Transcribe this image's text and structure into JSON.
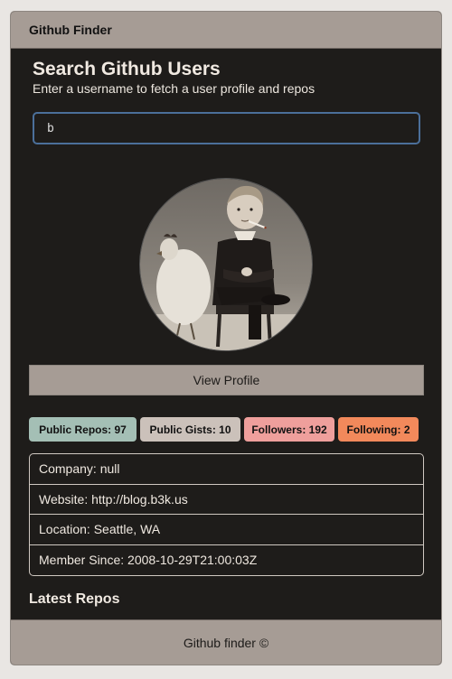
{
  "navbar": {
    "brand": "Github Finder"
  },
  "search": {
    "title": "Search Github Users",
    "subtitle": "Enter a username to fetch a user profile and repos",
    "value": "b",
    "accent_color": "#4b6f9a"
  },
  "profile": {
    "avatar_icon": "user-avatar-photo",
    "view_profile_label": "View Profile"
  },
  "badges": {
    "public_repos": "Public Repos: 97",
    "public_gists": "Public Gists: 10",
    "followers": "Followers: 192",
    "following": "Following: 2"
  },
  "info": {
    "company": "Company: null",
    "website": "Website: http://blog.b3k.us",
    "location": "Location: Seattle, WA",
    "member_since": "Member Since: 2008-10-29T21:00:03Z"
  },
  "repos": {
    "heading": "Latest Repos"
  },
  "footer": {
    "text": "Github finder ©"
  },
  "colors": {
    "navbar_bg": "#a69c95",
    "content_bg": "#1e1c1a",
    "badge_repos": "#a4bfb5",
    "badge_gists": "#cbc1ba",
    "badge_followers": "#ef9f9c",
    "badge_following": "#f2895b"
  }
}
